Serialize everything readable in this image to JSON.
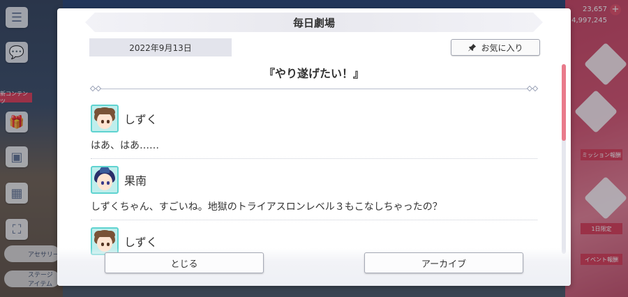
{
  "background": {
    "counter_top": "23,657",
    "counter_bottom": "4,997,245",
    "side_tag": "新コンテンツ",
    "pill_1": "アセサリー",
    "pill_2": "ステージ アイテム",
    "right_label_1": "ミッション報酬",
    "right_label_2": "1日限定",
    "right_label_3": "イベント報酬"
  },
  "dialog": {
    "title": "毎日劇場",
    "date": "2022年9月13日",
    "favorite_label": "お気に入り",
    "episode_title": "『やり遂げたい！』",
    "close_label": "とじる",
    "archive_label": "アーカイブ"
  },
  "entries": [
    {
      "speaker": "しずく",
      "text": "はあ、はあ……"
    },
    {
      "speaker": "果南",
      "text": "しずくちゃん、すごいね。地獄のトライアスロンレベル３もこなしちゃったの？"
    },
    {
      "speaker": "しずく",
      "text": ""
    }
  ],
  "colors": {
    "accent": "#e97b8b",
    "avatar_border": "#5fd3d0"
  }
}
